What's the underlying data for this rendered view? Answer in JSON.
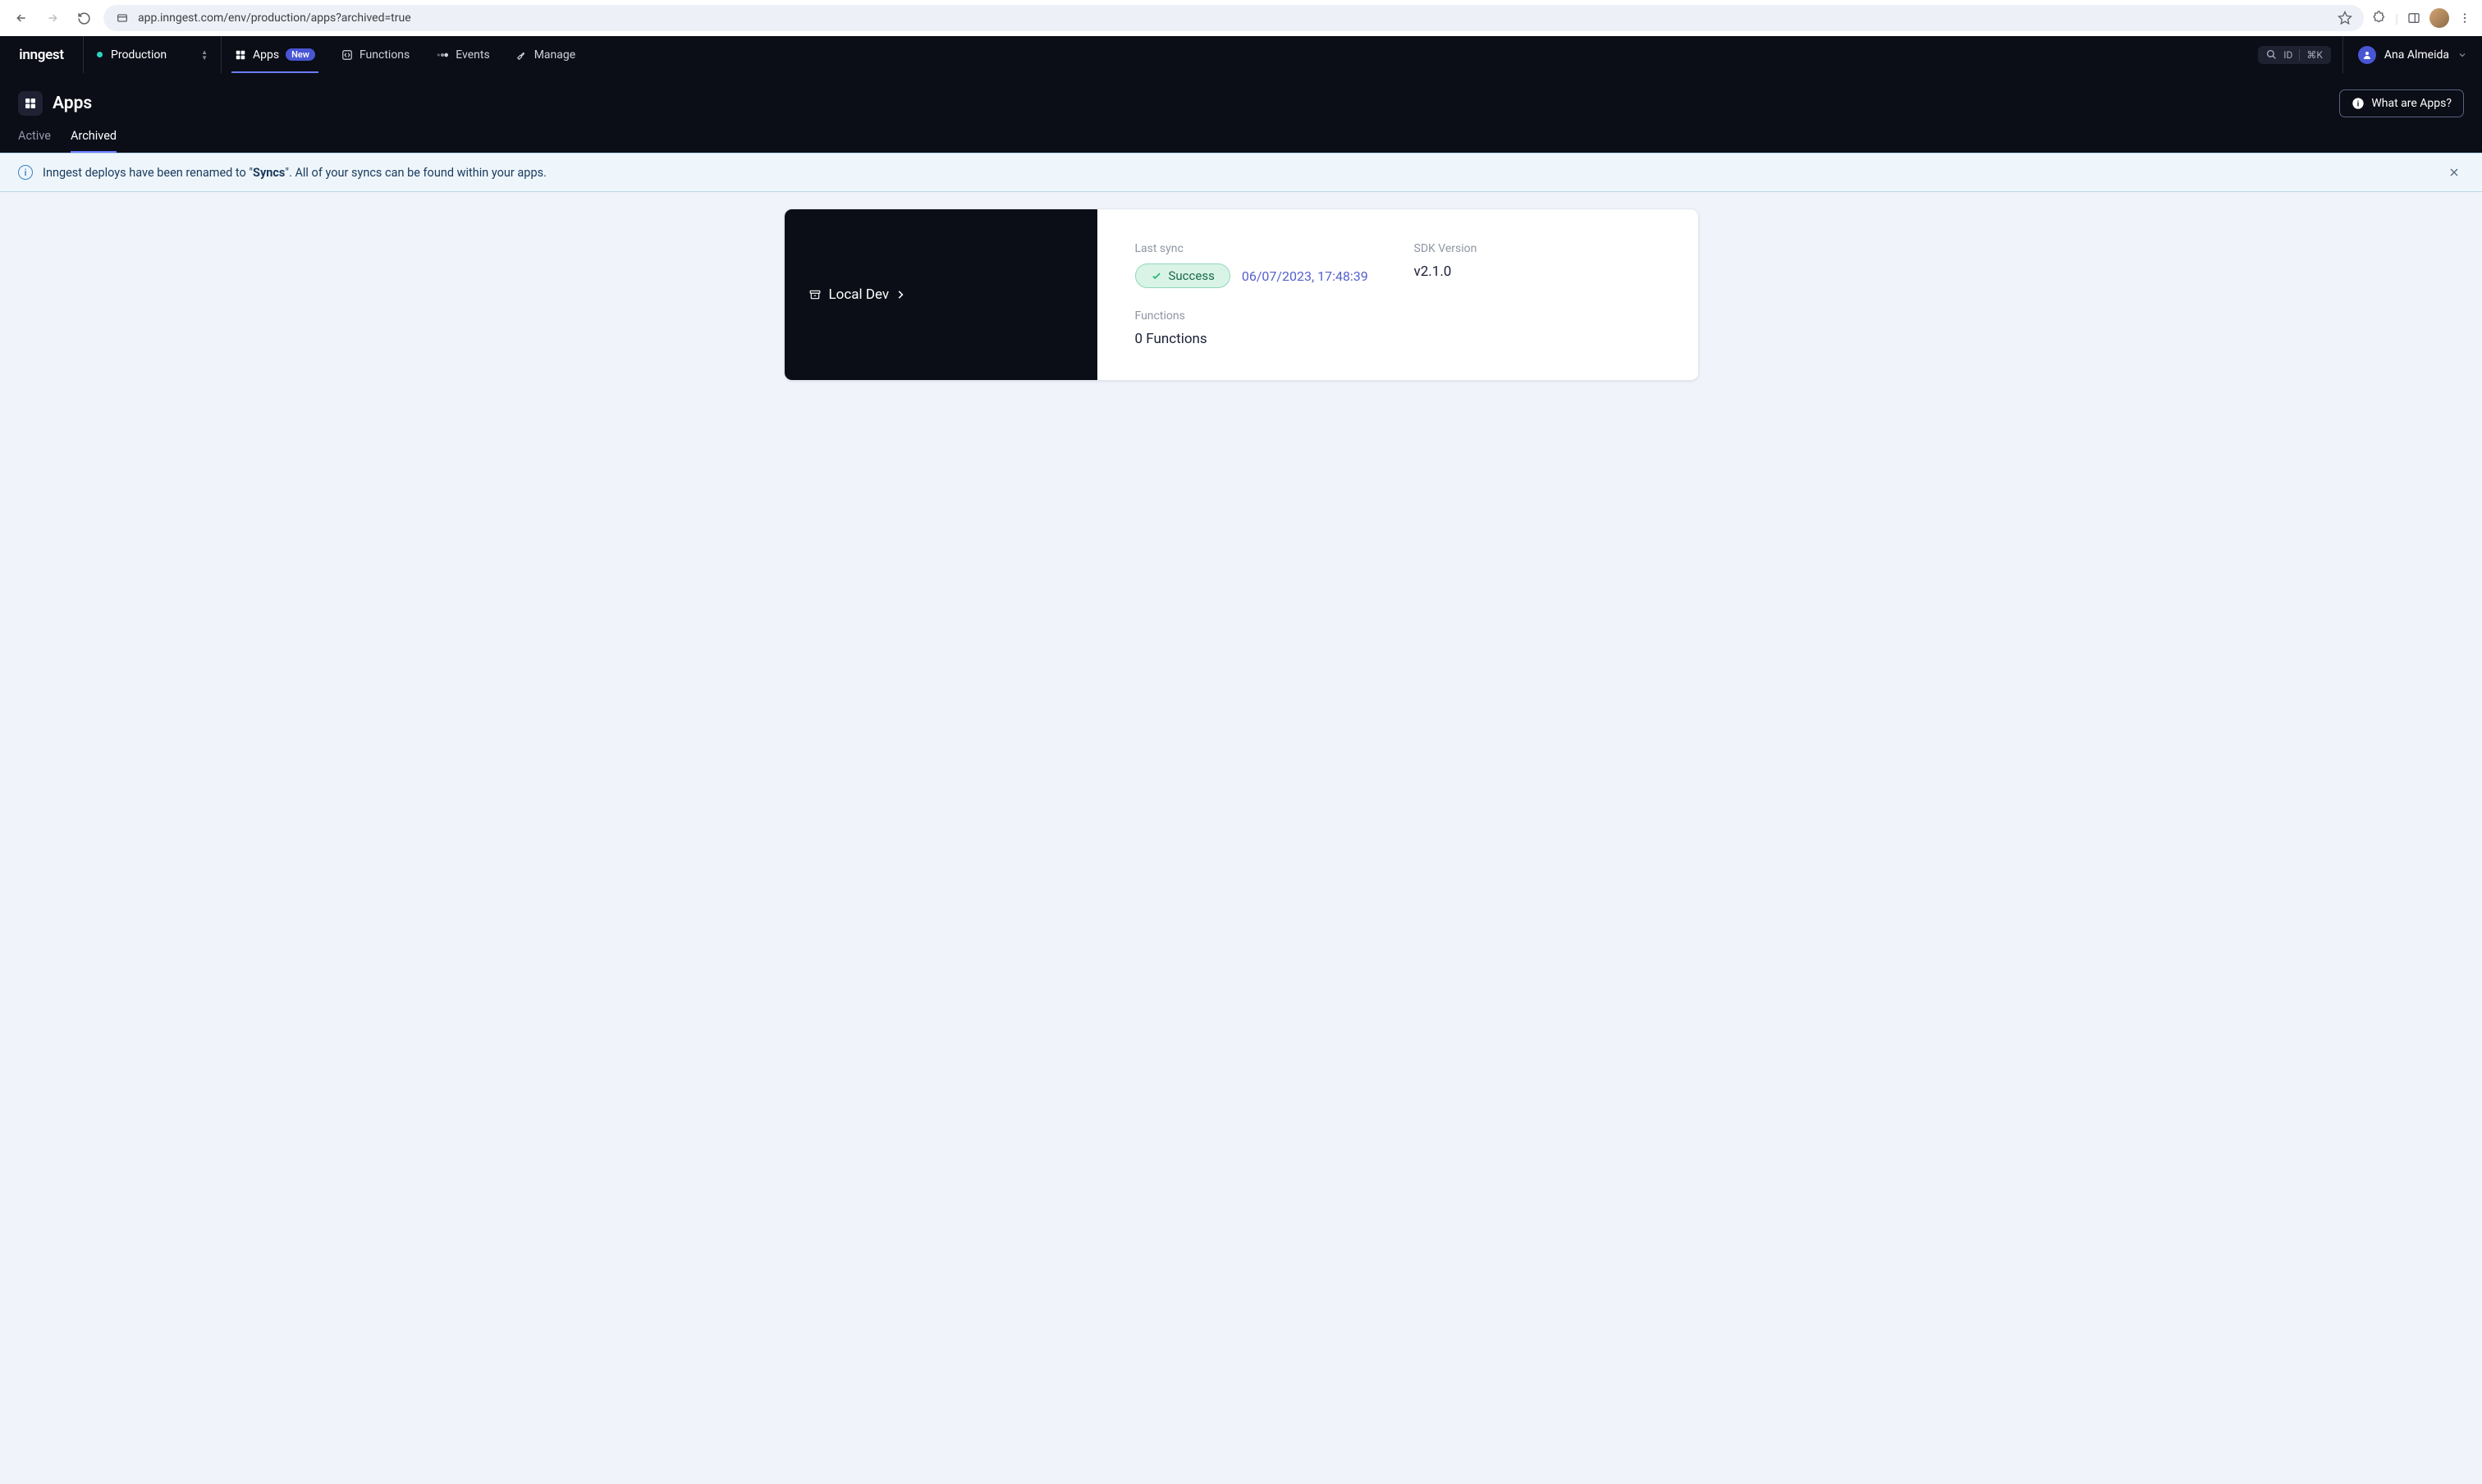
{
  "browser": {
    "url": "app.inngest.com/env/production/apps?archived=true"
  },
  "brand": "inngest",
  "env": {
    "name": "Production"
  },
  "nav": {
    "apps": "Apps",
    "apps_badge": "New",
    "functions": "Functions",
    "events": "Events",
    "manage": "Manage"
  },
  "search": {
    "id_label": "ID",
    "kbd": "⌘K"
  },
  "user": {
    "name": "Ana Almeida"
  },
  "page": {
    "title": "Apps",
    "help_button": "What are Apps?",
    "tabs": {
      "active": "Active",
      "archived": "Archived"
    }
  },
  "banner": {
    "prefix": "Inngest deploys have been renamed to \"",
    "bold": "Syncs",
    "suffix": "\". All of your syncs can be found within your apps."
  },
  "app": {
    "name": "Local Dev",
    "last_sync_label": "Last sync",
    "status": "Success",
    "timestamp": "06/07/2023, 17:48:39",
    "sdk_label": "SDK Version",
    "sdk_version": "v2.1.0",
    "functions_label": "Functions",
    "functions_count": "0 Functions"
  }
}
